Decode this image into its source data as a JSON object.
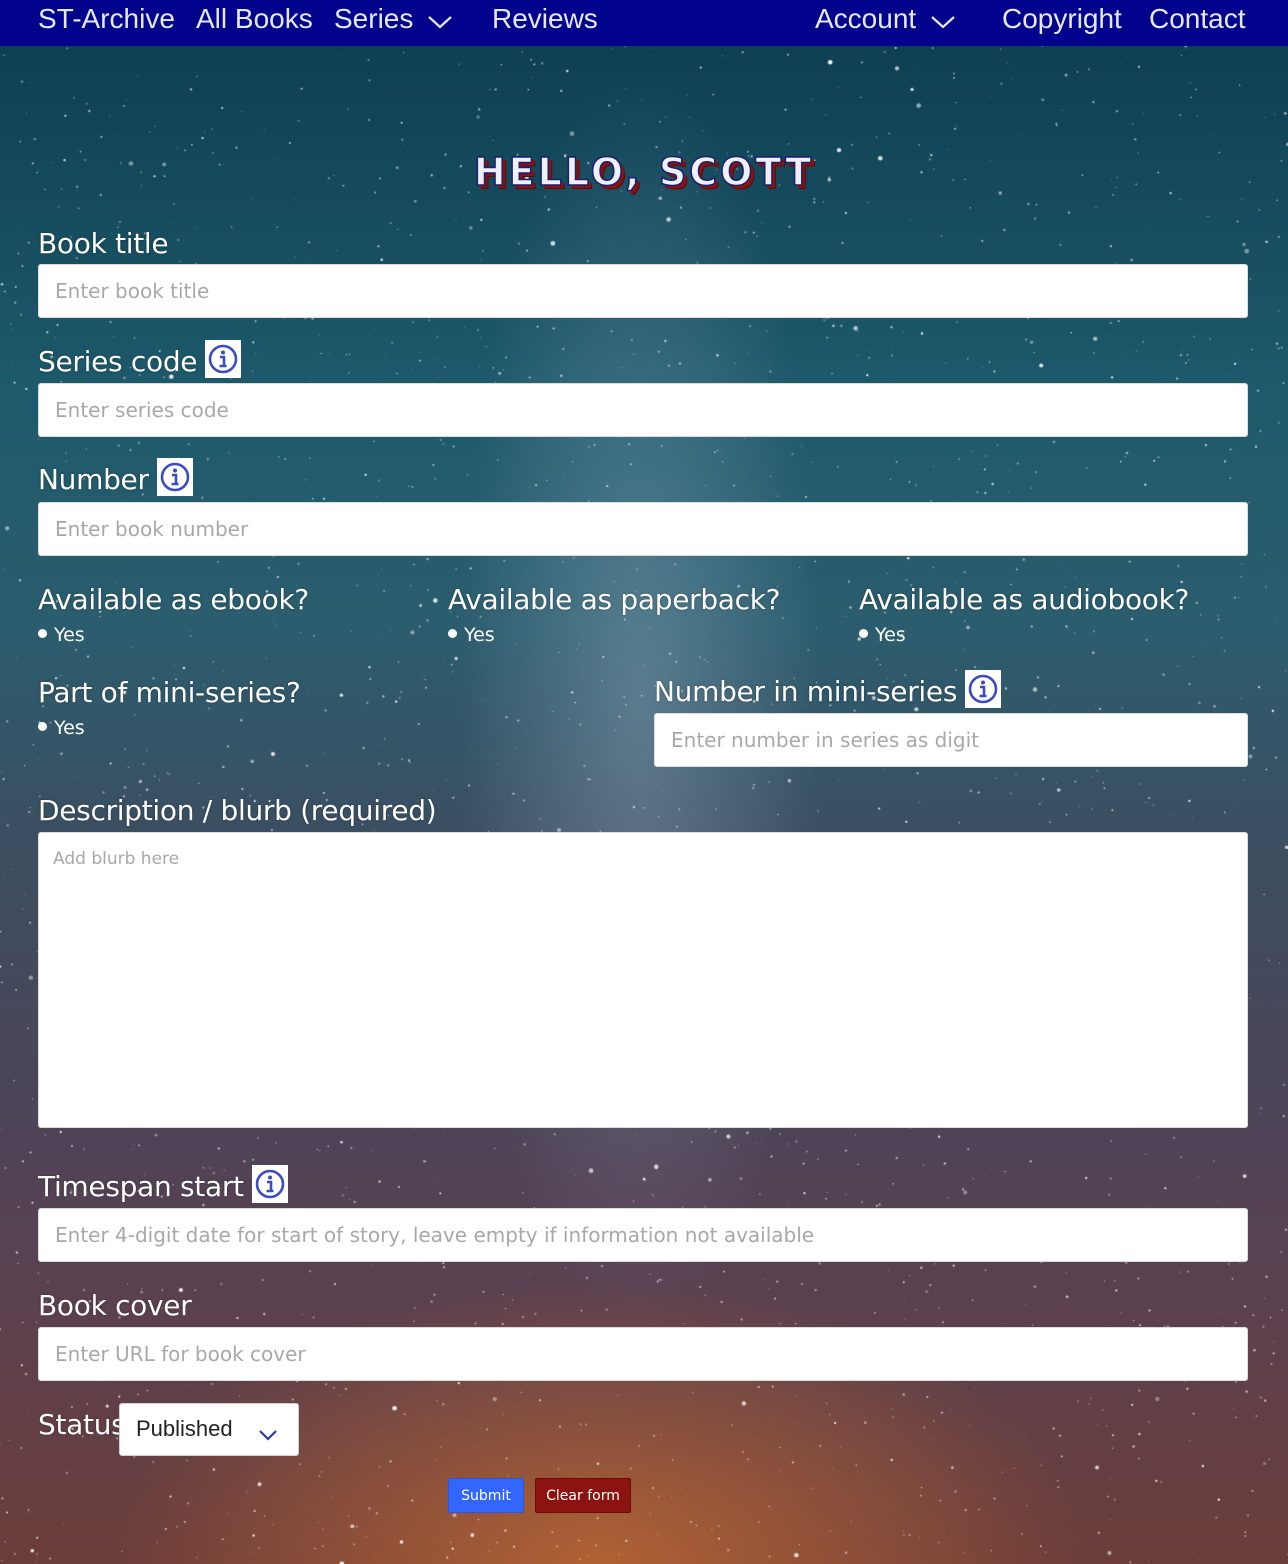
{
  "nav": {
    "brand": "ST-Archive",
    "all_books": "All Books",
    "series": "Series",
    "reviews": "Reviews",
    "account": "Account",
    "copyright": "Copyright",
    "contact": "Contact"
  },
  "greeting": "HELLO, SCOTT",
  "form": {
    "book_title": {
      "label": "Book title",
      "placeholder": "Enter book title"
    },
    "series_code": {
      "label": "Series code",
      "placeholder": "Enter series code"
    },
    "number": {
      "label": "Number",
      "placeholder": "Enter book number"
    },
    "ebook": {
      "label": "Available as ebook?",
      "option": "Yes"
    },
    "paperback": {
      "label": "Available as paperback?",
      "option": "Yes"
    },
    "audiobook": {
      "label": "Available as audiobook?",
      "option": "Yes"
    },
    "mini_series": {
      "label": "Part of mini-series?",
      "option": "Yes"
    },
    "number_in_mini_series": {
      "label": "Number in mini-series",
      "placeholder": "Enter number in series as digit"
    },
    "description": {
      "label": "Description / blurb (required)",
      "placeholder": "Add blurb here"
    },
    "timespan_start": {
      "label": "Timespan start",
      "placeholder": "Enter 4-digit date for start of story, leave empty if information not available"
    },
    "book_cover": {
      "label": "Book cover",
      "placeholder": "Enter URL for book cover"
    },
    "status": {
      "label": "Status",
      "value": "Published"
    }
  },
  "buttons": {
    "submit": "Submit",
    "clear": "Clear form"
  },
  "colors": {
    "navbar": "#02038c",
    "submit": "#3366ff",
    "clear": "#8b1410",
    "info_icon": "#3a4cc0"
  }
}
